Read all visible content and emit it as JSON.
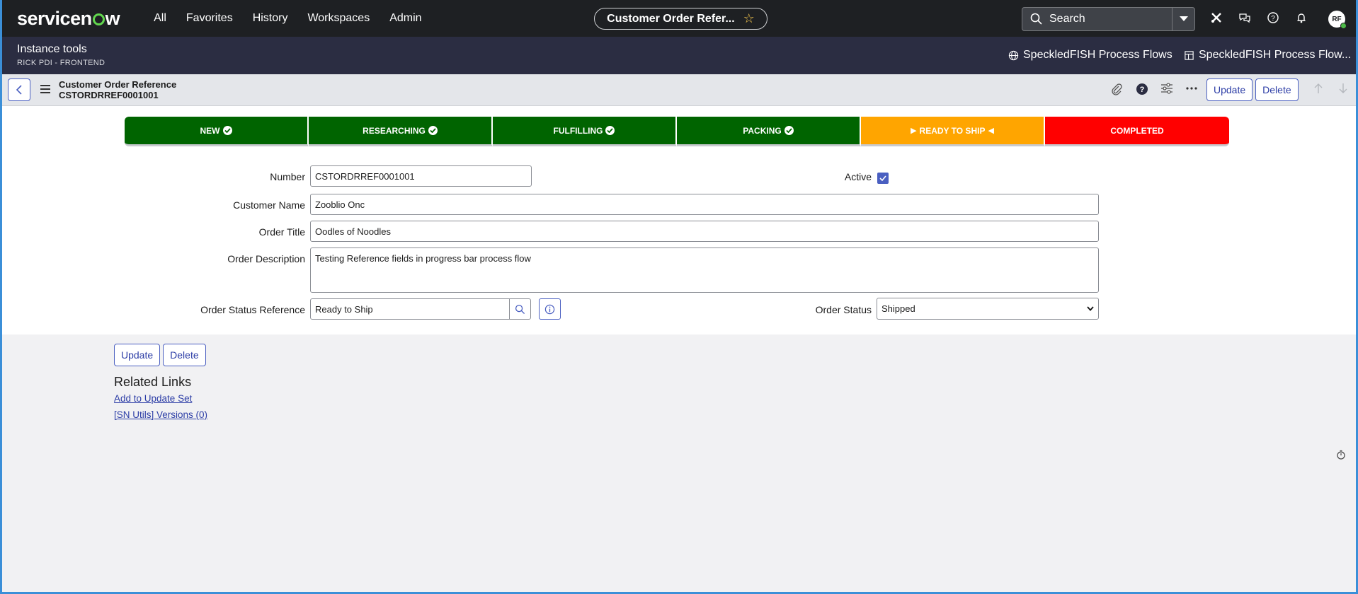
{
  "nav": {
    "logo_before": "servicen",
    "logo_after": "w",
    "menu": [
      "All",
      "Favorites",
      "History",
      "Workspaces",
      "Admin"
    ],
    "context_pill": "Customer Order Refer...",
    "search_placeholder": "Search",
    "avatar_initials": "RF"
  },
  "subnav": {
    "title": "Instance tools",
    "subtitle": "RICK PDI - FRONTEND",
    "links": [
      "SpeckledFISH Process Flows",
      "SpeckledFISH Process Flow..."
    ]
  },
  "header": {
    "record_type": "Customer Order Reference",
    "record_number": "CSTORDRREF0001001",
    "update_label": "Update",
    "delete_label": "Delete"
  },
  "process_flow": [
    {
      "label": "NEW",
      "state": "complete",
      "color": "#006400"
    },
    {
      "label": "RESEARCHING",
      "state": "complete",
      "color": "#006400"
    },
    {
      "label": "FULFILLING",
      "state": "complete",
      "color": "#006400"
    },
    {
      "label": "PACKING",
      "state": "complete",
      "color": "#006400"
    },
    {
      "label": "READY TO SHIP",
      "state": "current",
      "color": "#ffa500"
    },
    {
      "label": "COMPLETED",
      "state": "pending",
      "color": "#ff0000"
    }
  ],
  "form": {
    "number_label": "Number",
    "number_value": "CSTORDRREF0001001",
    "active_label": "Active",
    "active_checked": true,
    "customer_name_label": "Customer Name",
    "customer_name_value": "Zooblio Onc",
    "order_title_label": "Order Title",
    "order_title_value": "Oodles of Noodles",
    "order_description_label": "Order Description",
    "order_description_value": "Testing Reference fields in progress bar process flow",
    "order_status_ref_label": "Order Status Reference",
    "order_status_ref_value": "Ready to Ship",
    "order_status_label": "Order Status",
    "order_status_value": "Shipped"
  },
  "bottom": {
    "update_label": "Update",
    "delete_label": "Delete",
    "related_links_title": "Related Links",
    "links": [
      "Add to Update Set",
      "[SN Utils] Versions (0)"
    ]
  }
}
